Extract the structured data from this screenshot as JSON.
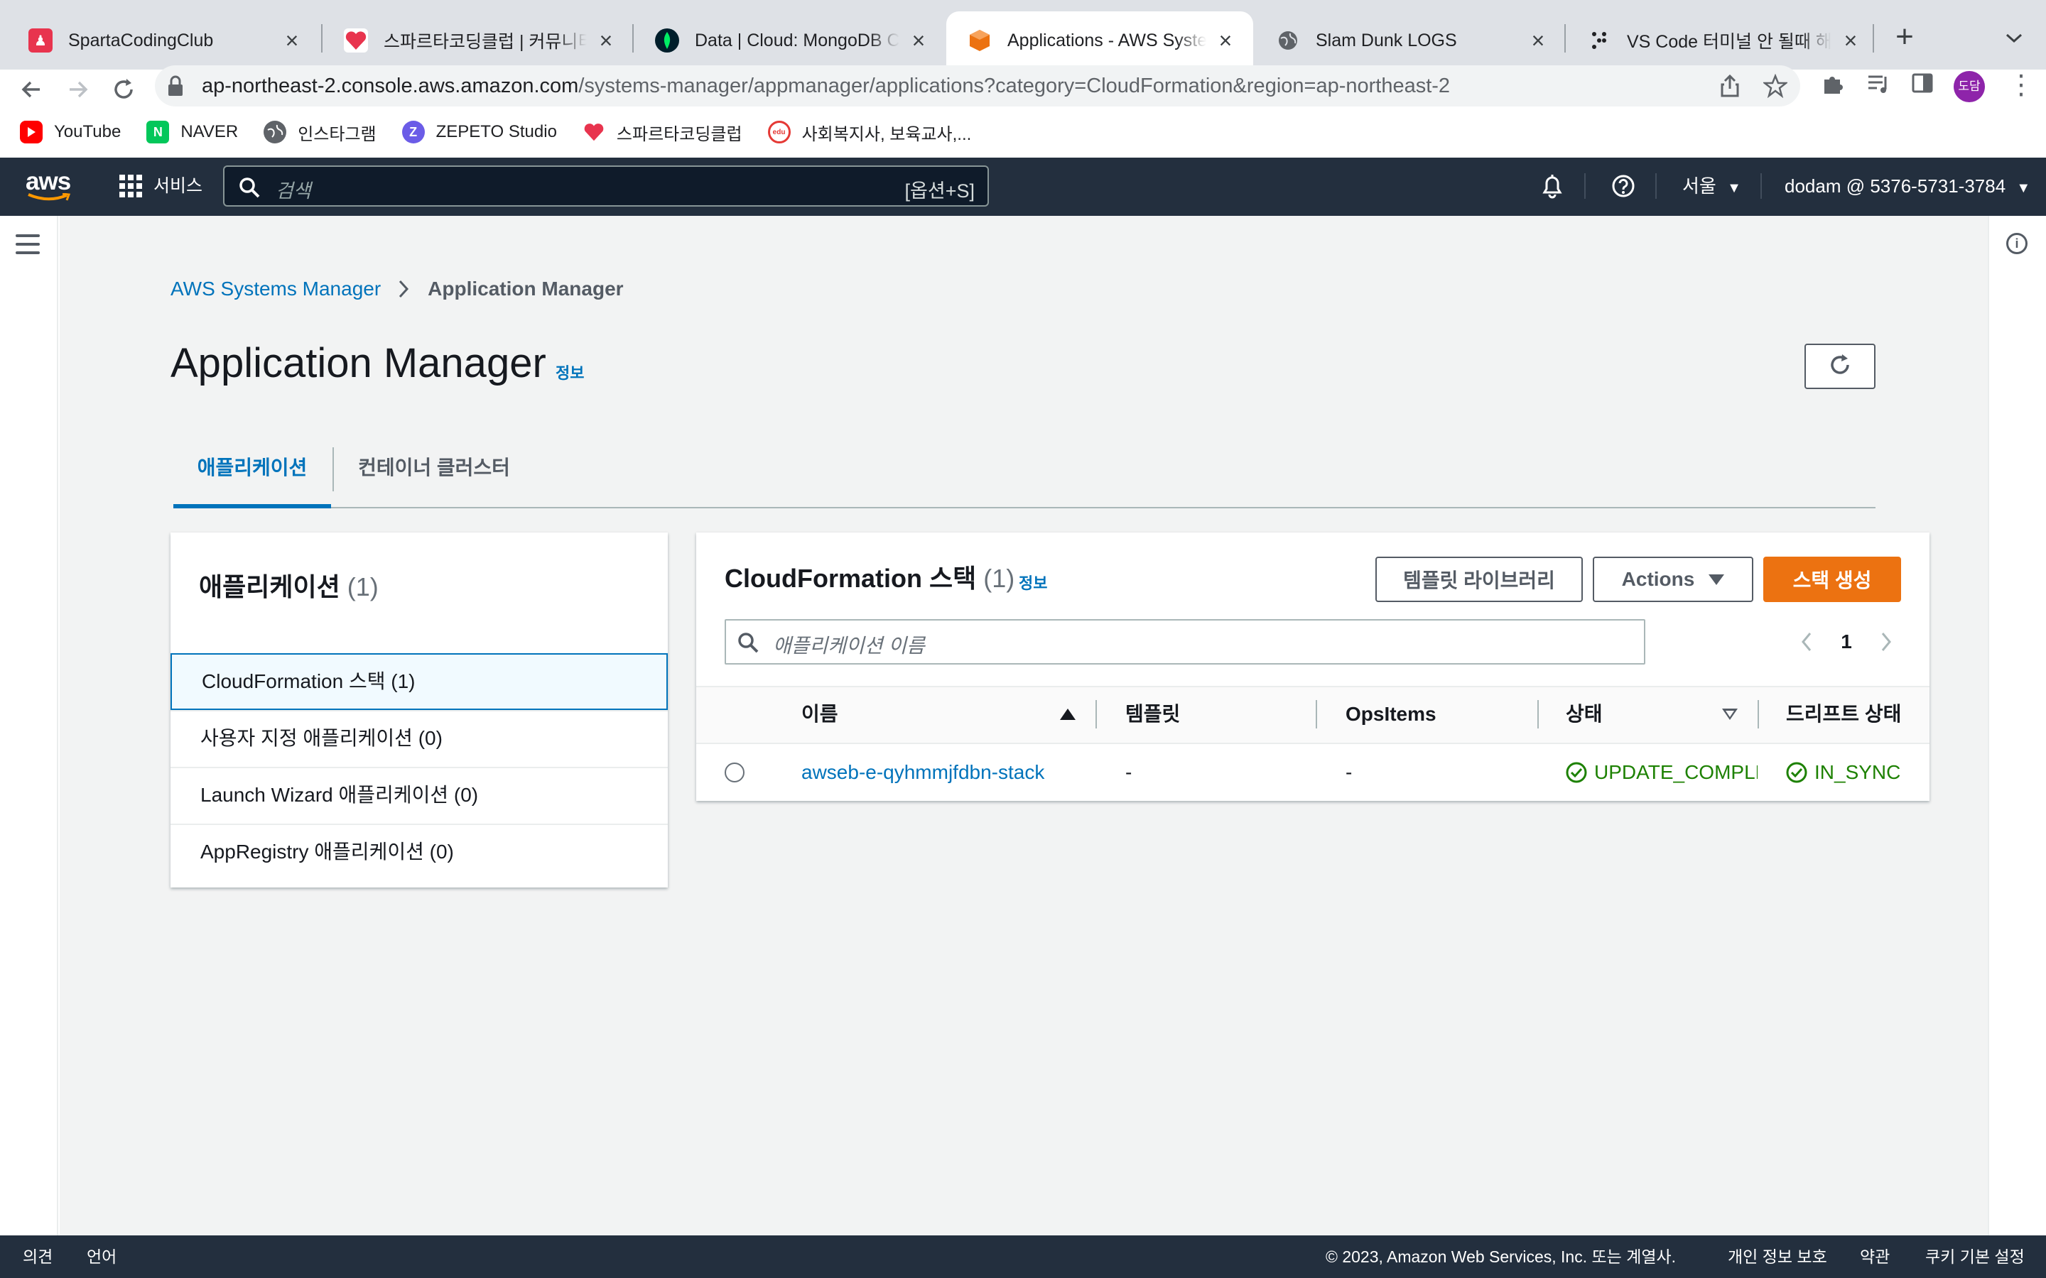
{
  "browser": {
    "tabs": [
      {
        "title": "SpartaCodingClub",
        "icon": "sparta-favicon"
      },
      {
        "title": "스파르타코딩클럽 | 커뮤니티",
        "icon": "sparta-heart-favicon"
      },
      {
        "title": "Data | Cloud: MongoDB Cloud",
        "icon": "mongodb-leaf-favicon"
      },
      {
        "title": "Applications - AWS Systems Manager",
        "icon": "aws-cube-favicon",
        "active": true
      },
      {
        "title": "Slam Dunk LOGS",
        "icon": "globe-favicon"
      },
      {
        "title": "VS Code 터미널 안 될때 해결법",
        "icon": "dots-favicon"
      }
    ],
    "new_tab_label": "+",
    "url_host": "ap-northeast-2.console.aws.amazon.com",
    "url_path": "/systems-manager/appmanager/applications?category=CloudFormation&region=ap-northeast-2",
    "profile_initials": "도담",
    "bookmarks": [
      {
        "label": "YouTube",
        "icon": "youtube-icon",
        "color": "#ff0000"
      },
      {
        "label": "NAVER",
        "icon": "naver-icon",
        "color": "#03c75a"
      },
      {
        "label": "인스타그램",
        "icon": "globe-icon",
        "color": "#5f6368"
      },
      {
        "label": "ZEPETO Studio",
        "icon": "zepeto-icon",
        "color": "#6b5ce7"
      },
      {
        "label": "스파르타코딩클럽",
        "icon": "sparta-heart-icon",
        "color": "#e8344e"
      },
      {
        "label": "사회복지사, 보육교사,...",
        "icon": "edu-icon",
        "color": "#e53935"
      }
    ]
  },
  "aws_nav": {
    "logo": "aws",
    "services_label": "서비스",
    "search_placeholder": "검색",
    "search_shortcut": "[옵션+S]",
    "region": "서울",
    "account": "dodam @ 5376-5731-3784"
  },
  "breadcrumb": {
    "root": "AWS Systems Manager",
    "current": "Application Manager"
  },
  "page": {
    "title": "Application Manager",
    "info_label": "정보"
  },
  "tabs": {
    "applications": "애플리케이션",
    "container_clusters": "컨테이너 클러스터"
  },
  "left_panel": {
    "heading": "애플리케이션",
    "count": "(1)",
    "items": [
      {
        "label": "CloudFormation 스택 (1)",
        "selected": true
      },
      {
        "label": "사용자 지정 애플리케이션 (0)"
      },
      {
        "label": "Launch Wizard 애플리케이션 (0)"
      },
      {
        "label": "AppRegistry 애플리케이션 (0)"
      }
    ]
  },
  "stacks_panel": {
    "heading": "CloudFormation 스택",
    "count": "(1)",
    "info_label": "정보",
    "template_library_button": "템플릿 라이브러리",
    "actions_button": "Actions",
    "create_stack_button": "스택 생성",
    "search_placeholder": "애플리케이션 이름",
    "page_number": "1",
    "columns": {
      "name": "이름",
      "template": "템플릿",
      "opsitems": "OpsItems",
      "status": "상태",
      "drift": "드리프트 상태"
    },
    "rows": [
      {
        "name": "awseb-e-qyhmmjfdbn-stack",
        "template": "-",
        "opsitems": "-",
        "status": "UPDATE_COMPLETE",
        "drift": "IN_SYNC"
      }
    ]
  },
  "footer": {
    "feedback": "의견",
    "language": "언어",
    "copyright": "© 2023, Amazon Web Services, Inc. 또는 계열사.",
    "privacy": "개인 정보 보호",
    "terms": "약관",
    "cookies": "쿠키 기본 설정"
  },
  "colors": {
    "aws_nav_bg": "#232f3e",
    "link_blue": "#0073bb",
    "primary_orange": "#ec7211",
    "success_green": "#1d8102"
  }
}
